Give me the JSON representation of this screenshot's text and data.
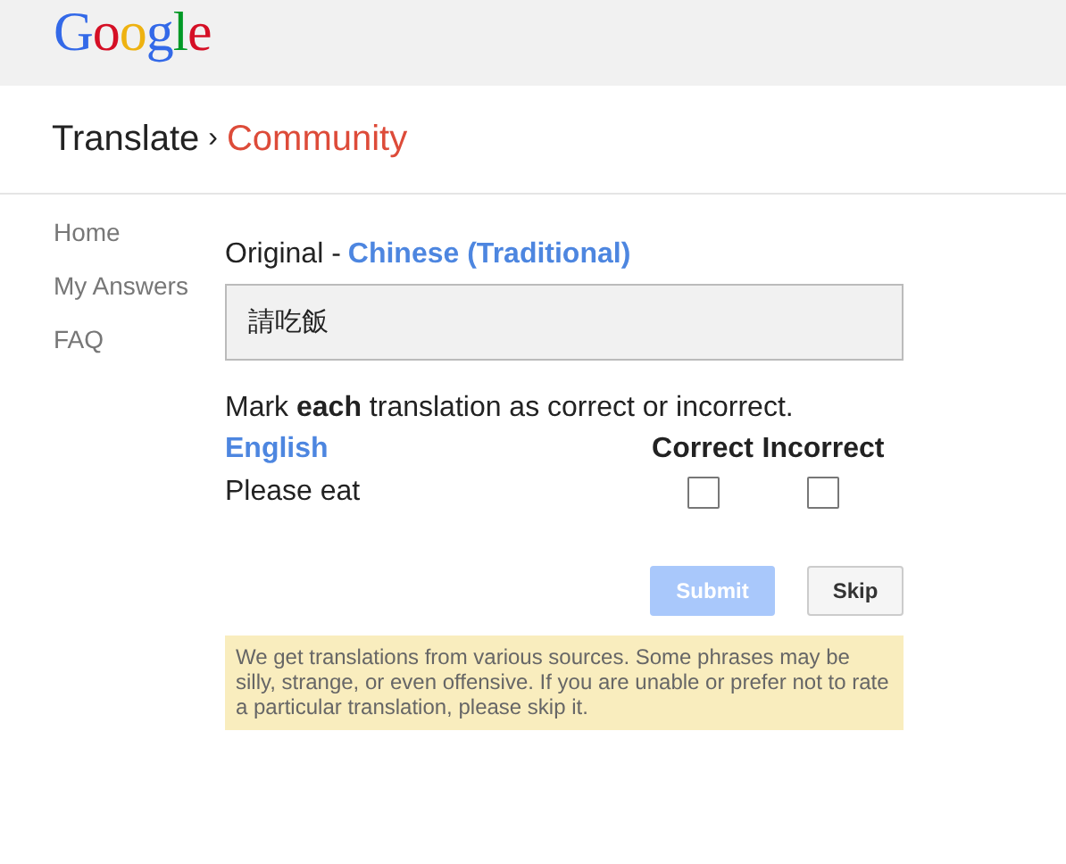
{
  "logo": [
    {
      "letter": "G",
      "color": "#3369e8"
    },
    {
      "letter": "o",
      "color": "#d50f25"
    },
    {
      "letter": "o",
      "color": "#eeb211"
    },
    {
      "letter": "g",
      "color": "#3369e8"
    },
    {
      "letter": "l",
      "color": "#009925"
    },
    {
      "letter": "e",
      "color": "#d50f25"
    }
  ],
  "breadcrumb": {
    "parent": "Translate",
    "separator": "›",
    "current": "Community"
  },
  "sidebar": {
    "items": [
      {
        "label": "Home"
      },
      {
        "label": "My Answers"
      },
      {
        "label": "FAQ"
      }
    ]
  },
  "original": {
    "label": "Original -",
    "language": "Chinese (Traditional)",
    "text": "請吃飯"
  },
  "instruction": "Mark **each** translation as correct or incorrect.",
  "table": {
    "columns": [
      "English",
      "Correct",
      "Incorrect"
    ],
    "rows": [
      {
        "text": "Please eat",
        "correct": false,
        "incorrect": false
      }
    ]
  },
  "buttons": [
    {
      "label": "Submit",
      "disabled": true
    },
    {
      "label": "Skip",
      "disabled": false
    }
  ],
  "notice": "We get translations from various sources. Some phrases may be silly, strange, or even offensive. If you are unable or prefer not to rate a particular translation, please skip it."
}
